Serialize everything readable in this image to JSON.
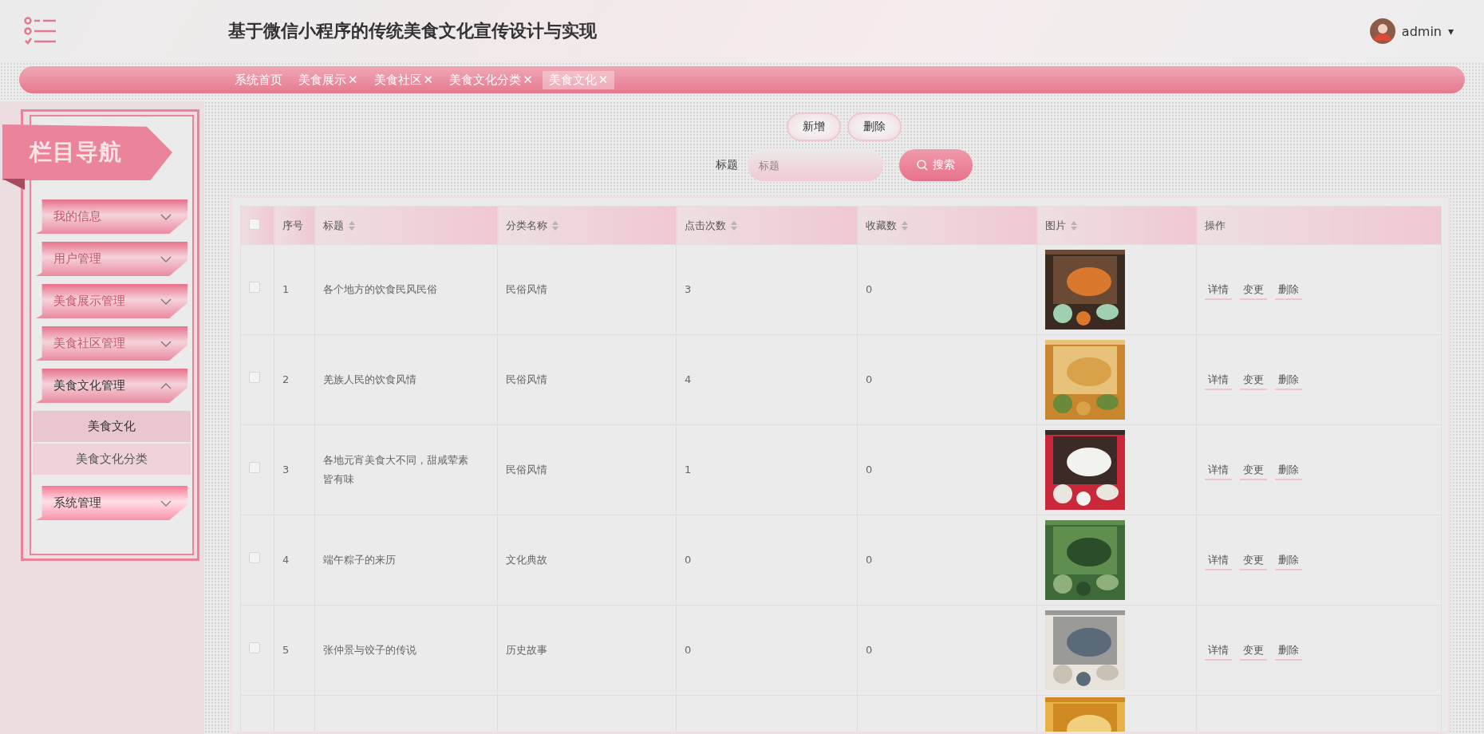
{
  "header": {
    "title": "基于微信小程序的传统美食文化宣传设计与实现",
    "user": "admin",
    "caret": "▾"
  },
  "tabs": [
    {
      "label": "系统首页",
      "selected": false
    },
    {
      "label": "美食展示",
      "close": "✕",
      "selected": false
    },
    {
      "label": "美食社区",
      "close": "✕",
      "selected": false
    },
    {
      "label": "美食文化分类",
      "close": "✕",
      "selected": false
    },
    {
      "label": "美食文化",
      "close": "✕",
      "selected": true
    }
  ],
  "sidebar": {
    "title": "栏目导航",
    "items": [
      {
        "label": "我的信息",
        "expanded": false,
        "hovered": false
      },
      {
        "label": "用户管理",
        "expanded": false,
        "hovered": false
      },
      {
        "label": "美食展示管理",
        "expanded": false,
        "hovered": false
      },
      {
        "label": "美食社区管理",
        "expanded": false,
        "hovered": false
      },
      {
        "label": "美食文化管理",
        "expanded": true,
        "hovered": false,
        "children": [
          {
            "label": "美食文化",
            "selected": true
          },
          {
            "label": "美食文化分类",
            "selected": false
          }
        ]
      },
      {
        "label": "系统管理",
        "expanded": false,
        "hovered": true
      }
    ]
  },
  "toolbar": {
    "buttons": [
      "新增",
      "删除"
    ],
    "search_label": "标题",
    "search_placeholder": "标题",
    "search_button": "搜索"
  },
  "table": {
    "select_all": false,
    "columns": [
      {
        "label": "序号",
        "sortable": false
      },
      {
        "label": "标题",
        "sortable": true
      },
      {
        "label": "分类名称",
        "sortable": true
      },
      {
        "label": "点击次数",
        "sortable": true
      },
      {
        "label": "收藏数",
        "sortable": true
      },
      {
        "label": "图片",
        "sortable": true
      },
      {
        "label": "操作",
        "sortable": false
      }
    ],
    "rows": [
      {
        "checked": false,
        "index": "1",
        "title": "各个地方的饮食民风民俗",
        "category": "民俗风情",
        "clicks": "3",
        "favorites": "0",
        "image": {
          "kind": "picture"
        },
        "actions": [
          "详情",
          "变更",
          "删除"
        ]
      },
      {
        "checked": false,
        "index": "2",
        "title": "羌族人民的饮食风情",
        "category": "民俗风情",
        "clicks": "4",
        "favorites": "0",
        "image": {
          "kind": "picture"
        },
        "actions": [
          "详情",
          "变更",
          "删除"
        ]
      },
      {
        "checked": false,
        "index": "3",
        "title": "各地元宵美食大不同，甜咸荤素皆有味",
        "category": "民俗风情",
        "clicks": "1",
        "favorites": "0",
        "image": {
          "kind": "picture"
        },
        "actions": [
          "详情",
          "变更",
          "删除"
        ]
      },
      {
        "checked": false,
        "index": "4",
        "title": "端午粽子的来历",
        "category": "文化典故",
        "clicks": "0",
        "favorites": "0",
        "image": {
          "kind": "picture"
        },
        "actions": [
          "详情",
          "变更",
          "删除"
        ]
      },
      {
        "checked": false,
        "index": "5",
        "title": "张仲景与饺子的传说",
        "category": "历史故事",
        "clicks": "0",
        "favorites": "0",
        "image": {
          "kind": "picture"
        },
        "actions": [
          "详情",
          "变更",
          "删除"
        ]
      },
      {
        "image": {
          "kind": "picture"
        }
      }
    ]
  }
}
